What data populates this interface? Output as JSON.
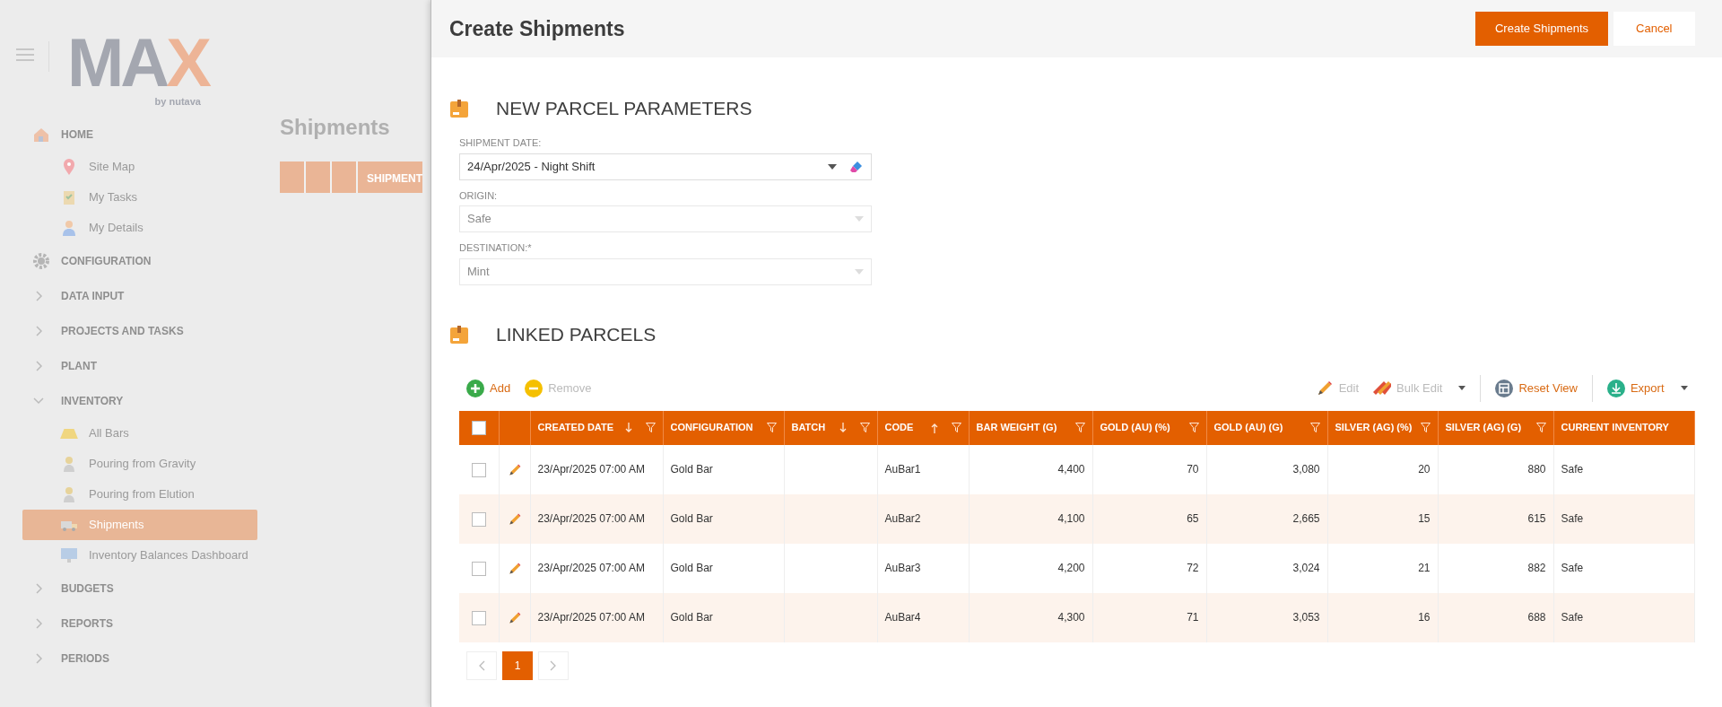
{
  "sidebar": {
    "logo": {
      "main": "MA",
      "accent": "X",
      "tagline": "by nutava"
    },
    "items": [
      {
        "kind": "section",
        "label": "HOME",
        "children": [
          {
            "label": "Site Map",
            "selected": false
          },
          {
            "label": "My Tasks",
            "selected": false
          },
          {
            "label": "My Details",
            "selected": false
          }
        ]
      },
      {
        "kind": "section",
        "label": "CONFIGURATION"
      },
      {
        "kind": "group",
        "label": "DATA INPUT",
        "expanded": false
      },
      {
        "kind": "group",
        "label": "PROJECTS AND TASKS",
        "expanded": false
      },
      {
        "kind": "group",
        "label": "PLANT",
        "expanded": false
      },
      {
        "kind": "group",
        "label": "INVENTORY",
        "expanded": true,
        "children": [
          {
            "label": "All Bars",
            "selected": false
          },
          {
            "label": "Pouring from Gravity",
            "selected": false
          },
          {
            "label": "Pouring from Elution",
            "selected": false
          },
          {
            "label": "Shipments",
            "selected": true
          },
          {
            "label": "Inventory Balances Dashboard",
            "selected": false
          }
        ]
      },
      {
        "kind": "group",
        "label": "BUDGETS",
        "expanded": false
      },
      {
        "kind": "group",
        "label": "REPORTS",
        "expanded": false
      },
      {
        "kind": "group",
        "label": "PERIODS",
        "expanded": false
      }
    ]
  },
  "background_page": {
    "title": "Shipments",
    "grid_columns": [
      "SHIPMENT"
    ]
  },
  "dialog": {
    "title": "Create Shipments",
    "buttons": [
      {
        "label": "Create Shipments",
        "kind": "primary"
      },
      {
        "label": "Cancel",
        "kind": "secondary"
      }
    ],
    "parameters": {
      "title": "NEW PARCEL PARAMETERS",
      "fields": [
        {
          "label": "SHIPMENT DATE:",
          "value": "24/Apr/2025 - Night Shift",
          "disabled": false,
          "clearable": true
        },
        {
          "label": "ORIGIN:",
          "value": "Safe",
          "disabled": true,
          "clearable": false
        },
        {
          "label": "DESTINATION:*",
          "value": "Mint",
          "disabled": true,
          "clearable": false
        }
      ]
    },
    "linked_parcels": {
      "title": "LINKED PARCELS",
      "toolbar_left": [
        {
          "kind": "add",
          "label": "Add",
          "disabled": false
        },
        {
          "kind": "remove",
          "label": "Remove",
          "disabled": true
        }
      ],
      "toolbar_right": [
        {
          "kind": "edit",
          "label": "Edit",
          "disabled": true,
          "menu": false
        },
        {
          "kind": "bulk_edit",
          "label": "Bulk Edit",
          "disabled": true,
          "menu": true
        },
        {
          "kind": "reset",
          "label": "Reset View",
          "disabled": false,
          "menu": false
        },
        {
          "kind": "export",
          "label": "Export",
          "disabled": false,
          "menu": true
        }
      ],
      "header_checked": false,
      "columns": [
        {
          "label": "CREATED DATE",
          "sorted_asc": false,
          "sorted_desc": true,
          "filter": true
        },
        {
          "label": "CONFIGURATION",
          "sorted_asc": false,
          "sorted_desc": false,
          "filter": true
        },
        {
          "label": "BATCH",
          "sorted_asc": false,
          "sorted_desc": true,
          "filter": true
        },
        {
          "label": "CODE",
          "sorted_asc": true,
          "sorted_desc": false,
          "filter": true
        },
        {
          "label": "BAR WEIGHT (G)",
          "sorted_asc": false,
          "sorted_desc": false,
          "filter": true
        },
        {
          "label": "GOLD (AU) (%)",
          "sorted_asc": false,
          "sorted_desc": false,
          "filter": true
        },
        {
          "label": "GOLD (AU) (G)",
          "sorted_asc": false,
          "sorted_desc": false,
          "filter": true
        },
        {
          "label": "SILVER (AG) (%)",
          "sorted_asc": false,
          "sorted_desc": false,
          "filter": true
        },
        {
          "label": "SILVER (AG) (G)",
          "sorted_asc": false,
          "sorted_desc": false,
          "filter": true
        },
        {
          "label": "CURRENT INVENTORY",
          "sorted_asc": false,
          "sorted_desc": false,
          "filter": false
        }
      ],
      "rows": [
        {
          "selected": false,
          "cells": [
            "23/Apr/2025 07:00 AM",
            "Gold Bar",
            "",
            "AuBar1",
            "4,400",
            "70",
            "3,080",
            "20",
            "880",
            "Safe"
          ]
        },
        {
          "selected": false,
          "cells": [
            "23/Apr/2025 07:00 AM",
            "Gold Bar",
            "",
            "AuBar2",
            "4,100",
            "65",
            "2,665",
            "15",
            "615",
            "Safe"
          ]
        },
        {
          "selected": false,
          "cells": [
            "23/Apr/2025 07:00 AM",
            "Gold Bar",
            "",
            "AuBar3",
            "4,200",
            "72",
            "3,024",
            "21",
            "882",
            "Safe"
          ]
        },
        {
          "selected": false,
          "cells": [
            "23/Apr/2025 07:00 AM",
            "Gold Bar",
            "",
            "AuBar4",
            "4,300",
            "71",
            "3,053",
            "16",
            "688",
            "Safe"
          ]
        }
      ],
      "pages": [
        {
          "label": "1",
          "selected": true
        }
      ]
    }
  }
}
